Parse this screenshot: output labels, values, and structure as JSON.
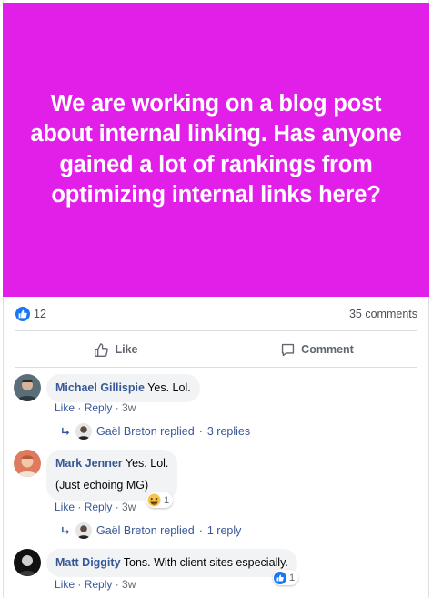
{
  "post": {
    "text": "We are working on a blog post about internal linking. Has anyone gained a lot of rankings from optimizing internal links here?",
    "background_color": "#e11fe8"
  },
  "stats": {
    "like_count": "12",
    "comments_count": "35 comments"
  },
  "actions": {
    "like_label": "Like",
    "comment_label": "Comment"
  },
  "comments": [
    {
      "author": "Michael Gillispie",
      "lines": [
        "Yes. Lol."
      ],
      "like": "Like",
      "reply": "Reply",
      "time": "3w",
      "replies": {
        "name": "Gaël Breton replied",
        "count": "3 replies"
      }
    },
    {
      "author": "Mark Jenner",
      "lines": [
        "Yes. Lol.",
        "(Just echoing MG)"
      ],
      "like": "Like",
      "reply": "Reply",
      "time": "3w",
      "reaction": {
        "icon": "haha-emoji-icon",
        "count": "1"
      },
      "replies": {
        "name": "Gaël Breton replied",
        "count": "1 reply"
      }
    },
    {
      "author": "Matt Diggity",
      "lines": [
        "Tons. With client sites especially."
      ],
      "like": "Like",
      "reply": "Reply",
      "time": "3w",
      "reaction": {
        "icon": "like-reaction-icon",
        "count": "1"
      }
    }
  ],
  "separator": " · "
}
